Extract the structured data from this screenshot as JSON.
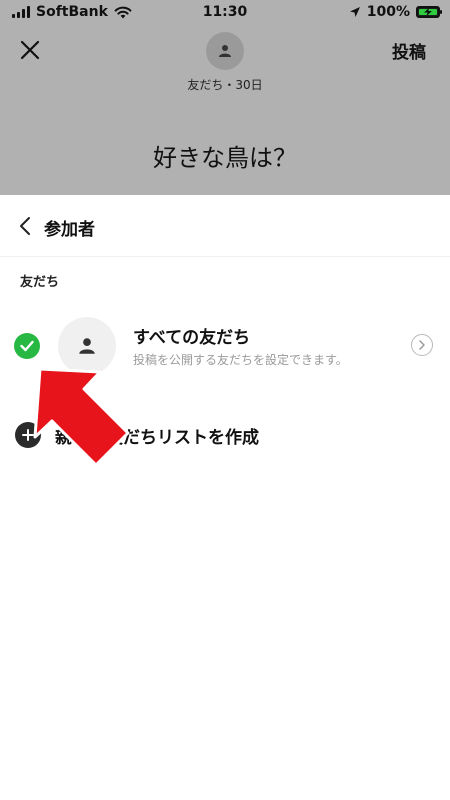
{
  "status_bar": {
    "carrier": "SoftBank",
    "time": "11:30",
    "battery_percent": "100%",
    "battery_level": 1.0,
    "battery_color": "#2ecc40"
  },
  "composer": {
    "close_icon": "close-icon",
    "post_label": "投稿",
    "audience": "友だち・30日",
    "post_text": "好きな鳥は？"
  },
  "sheet": {
    "back_icon": "chevron-left-icon",
    "title": "参加者",
    "section_label": "友だち",
    "all_friends": {
      "title": "すべての友だち",
      "subtitle": "投稿を公開する友だちを設定できます。",
      "selected": true,
      "check_color": "#27b844"
    },
    "create_list_label": "親しい友だちリストを作成"
  },
  "overlay": {
    "arrow_color": "#e8141b"
  }
}
